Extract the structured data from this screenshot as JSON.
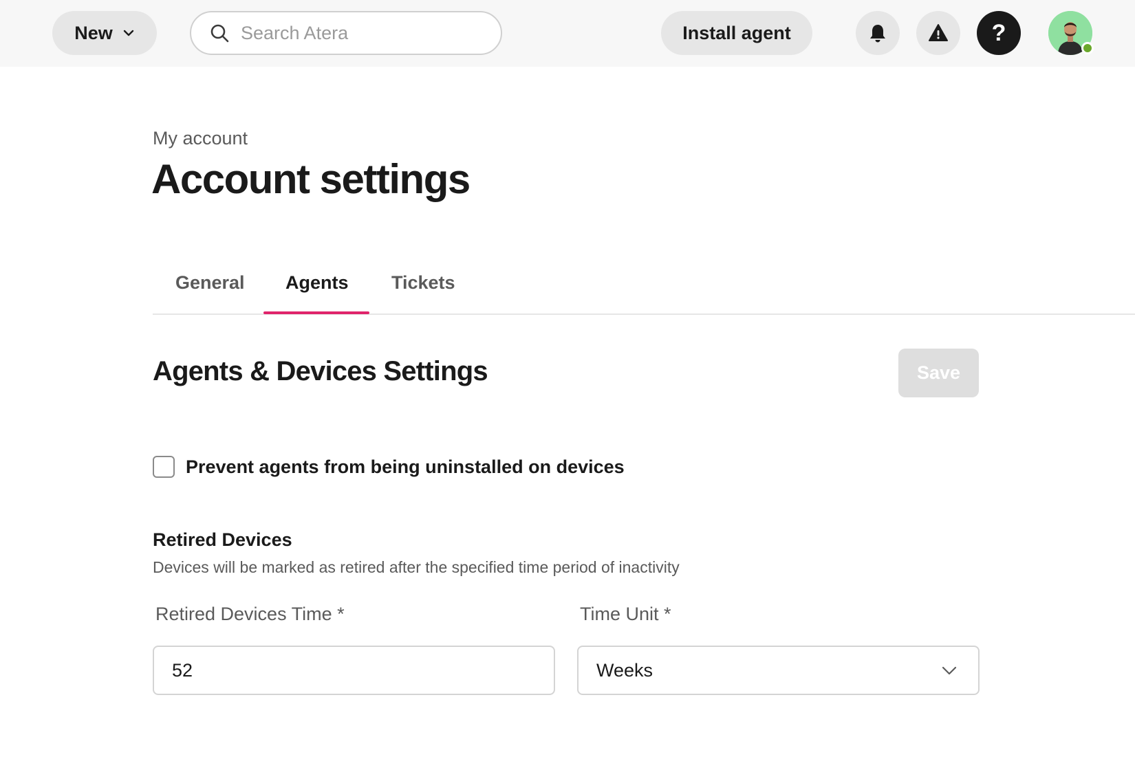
{
  "header": {
    "new_label": "New",
    "search_placeholder": "Search Atera",
    "install_label": "Install agent",
    "help_glyph": "?",
    "icons": [
      "chevron-down-icon",
      "search-icon",
      "bell-icon",
      "alert-triangle-icon",
      "help-icon",
      "user-avatar"
    ],
    "status_color": "#6aa82b"
  },
  "page": {
    "breadcrumb": "My account",
    "title": "Account settings"
  },
  "tabs": [
    {
      "label": "General",
      "active": false
    },
    {
      "label": "Agents",
      "active": true
    },
    {
      "label": "Tickets",
      "active": false
    }
  ],
  "accent_color": "#e0246b",
  "section": {
    "title": "Agents & Devices Settings",
    "save_label": "Save",
    "save_enabled": false
  },
  "prevent_uninstall": {
    "label": "Prevent agents from being uninstalled on devices",
    "checked": false
  },
  "retired": {
    "heading": "Retired Devices",
    "description": "Devices will be marked as retired after the specified time period of inactivity",
    "time_label": "Retired Devices Time *",
    "time_value": "52",
    "unit_label": "Time Unit *",
    "unit_value": "Weeks"
  }
}
